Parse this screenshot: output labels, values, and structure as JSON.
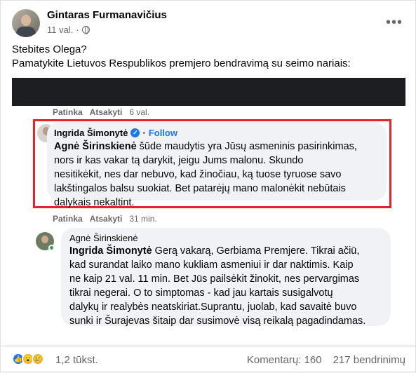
{
  "post": {
    "author": "Gintaras Furmanavičius",
    "time": "11 val.",
    "separator": "·",
    "more": "•••",
    "text_line1": "Stebites Olega?",
    "text_line2": "Pamatykite Lietuvos Respublikos premjero bendravimą su seimo nariais:"
  },
  "screenshot": {
    "top_actions": {
      "like": "Patinka",
      "reply": "Atsakyti",
      "time": "6 val."
    },
    "comment1": {
      "name": "Ingrida Šimonytė",
      "separator": "·",
      "follow": "Follow",
      "mention": "Agnė Širinskienė",
      "line1": " šūde maudytis yra Jūsų asmeninis pasirinkimas,",
      "line2": "nors ir kas vakar tą darykit, jeigu Jums malonu. Skundo",
      "line3": "nesitikėkit, nes dar nebuvo, kad žinočiau, ką tuose tyruose savo",
      "line4": "lakštingalos balsu suokiat. Bet patarėjų mano malonėkit nebūtais",
      "line5": "dalykais nekaltint.",
      "actions": {
        "like": "Patinka",
        "reply": "Atsakyti",
        "time": "31 min."
      }
    },
    "comment2": {
      "name": "Agnė Širinskienė",
      "mention": "Ingrida Šimonytė",
      "line1": " Gerą vakarą, Gerbiama Premjere. Tikrai ačiū,",
      "line2": "kad surandat laiko mano kukliam asmeniui ir dar naktimis. Kaip",
      "line3": "ne kaip 21 val. 11 min. Bet Jūs pailsėkit žinokit, nes pervargimas",
      "line4": "tikrai negerai. O to simptomas - kad jau kartais susigalvotų",
      "line5": "dalykų ir realybės neatskiriat.Suprantu, juolab, kad savaitė buvo",
      "line6": "sunki ir Šurajevas šitaip dar susimovė visą reikalą pagadindamas."
    }
  },
  "footer": {
    "reactions": [
      "like-icon",
      "wow-icon",
      "sad-icon"
    ],
    "reaction_count": "1,2 tūkst.",
    "comments": "Komentarų: 160",
    "shares": "217 bendrinimų"
  },
  "colors": {
    "accent": "#1877f2",
    "highlight_box": "#e0262b"
  }
}
